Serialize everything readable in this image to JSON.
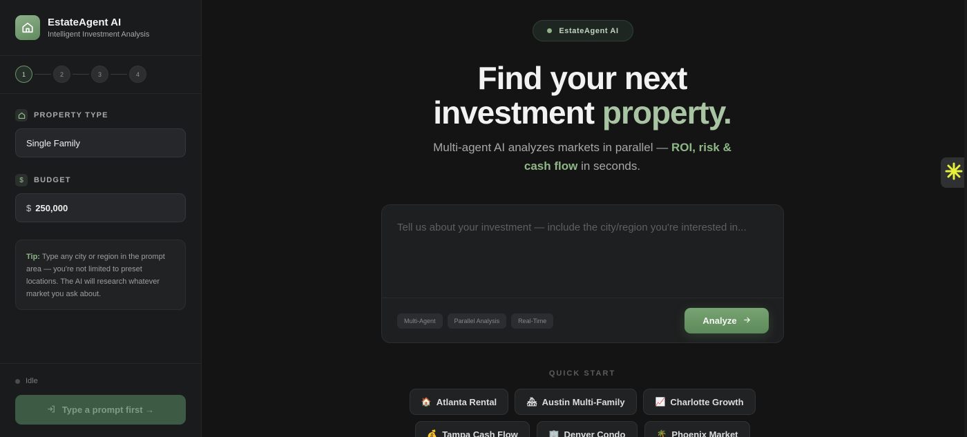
{
  "brand": {
    "title": "EstateAgent AI",
    "subtitle": "Intelligent Investment Analysis",
    "icon": "house-icon"
  },
  "steps": [
    "1",
    "2",
    "3",
    "4"
  ],
  "active_step": "1",
  "property_type": {
    "label": "PROPERTY TYPE",
    "icon": "house-icon",
    "value": "Single Family"
  },
  "budget": {
    "label": "BUDGET",
    "icon": "dollar-icon",
    "currency": "$",
    "value": "250,000"
  },
  "tip": {
    "key": "Tip:",
    "text": "Type any city or region in the prompt area — you're not limited to preset locations. The AI will research whatever market you ask about."
  },
  "status": {
    "text": "Idle"
  },
  "submit": {
    "label": "Type a prompt first →",
    "icon": "enter-icon"
  },
  "badge": {
    "text": "EstateAgent AI"
  },
  "hero": {
    "line1": "Find your next",
    "line2_plain": "investment",
    "line2_accent": "property."
  },
  "subtitle": {
    "part1": "Multi-agent AI analyzes markets in parallel — ",
    "highlight1": "ROI, risk &",
    "highlight2": "cash flow",
    "part2": " in seconds."
  },
  "prompt": {
    "placeholder": "Tell us about your investment — include the city/region you're interested in...",
    "value": ""
  },
  "chips": [
    "Multi-Agent",
    "Parallel Analysis",
    "Real-Time"
  ],
  "analyze": {
    "label": "Analyze",
    "icon": "arrow-right-icon"
  },
  "quick_start": {
    "title": "QUICK START",
    "items": [
      {
        "emoji": "🏠",
        "label": "Atlanta Rental"
      },
      {
        "emoji": "🏘",
        "label": "Austin Multi-Family"
      },
      {
        "emoji": "📈",
        "label": "Charlotte Growth"
      },
      {
        "emoji": "💰",
        "label": "Tampa Cash Flow"
      },
      {
        "emoji": "🏢",
        "label": "Denver Condo"
      },
      {
        "emoji": "🌴",
        "label": "Phoenix Market"
      }
    ]
  },
  "colors": {
    "accent": "#8fb887",
    "background": "#141414",
    "sidebar": "#1a1b1c"
  }
}
